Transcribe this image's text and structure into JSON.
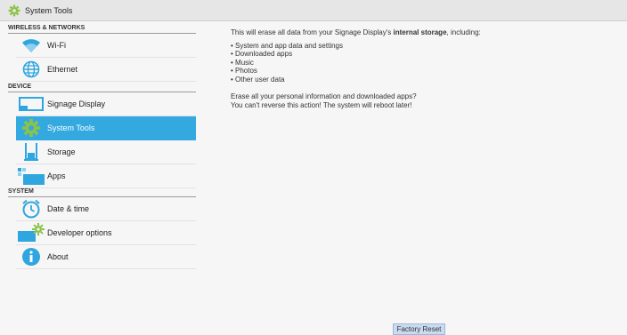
{
  "window": {
    "title": "System Tools"
  },
  "sidebar": {
    "sections": [
      {
        "header": "WIRELESS & NETWORKS",
        "items": [
          {
            "label": "Wi-Fi",
            "icon": "wifi-icon"
          },
          {
            "label": "Ethernet",
            "icon": "globe-icon"
          }
        ]
      },
      {
        "header": "DEVICE",
        "items": [
          {
            "label": "Signage Display",
            "icon": "display-icon"
          },
          {
            "label": "System Tools",
            "icon": "gear-icon",
            "selected": true
          },
          {
            "label": "Storage",
            "icon": "storage-icon"
          },
          {
            "label": "Apps",
            "icon": "apps-icon"
          }
        ]
      },
      {
        "header": "SYSTEM",
        "items": [
          {
            "label": "Date & time",
            "icon": "clock-icon"
          },
          {
            "label": "Developer options",
            "icon": "developer-icon"
          },
          {
            "label": "About",
            "icon": "info-icon"
          }
        ]
      }
    ]
  },
  "main": {
    "intro_before": "This will erase all data from your Signage Display's ",
    "intro_bold": "internal storage",
    "intro_after": ", including:",
    "bullets": [
      "• System and app data and settings",
      "• Downloaded apps",
      "• Music",
      "• Photos",
      "• Other user data"
    ],
    "warning_line1": "Erase all your personal information and downloaded apps?",
    "warning_line2": "You can't reverse this action! The system will reboot later!",
    "reset_button": "Factory Reset"
  },
  "colors": {
    "accent": "#33a9e0",
    "icon_blue": "#2fa6df",
    "button_bg": "#c9dbf1"
  }
}
